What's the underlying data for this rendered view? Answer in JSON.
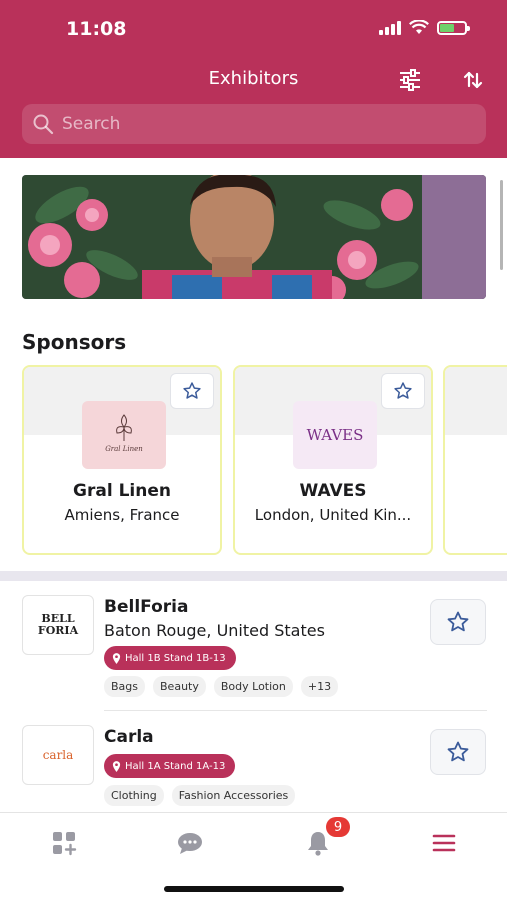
{
  "status_bar": {
    "time": "11:08",
    "battery_color": "#6fd16a"
  },
  "header": {
    "title": "Exhibitors",
    "filter_icon": "sliders-icon",
    "sort_icon": "sort-arrows-icon",
    "bg_color": "#b9315a"
  },
  "search": {
    "placeholder": "Search"
  },
  "sponsors": {
    "title": "Sponsors",
    "items": [
      {
        "name": "Gral Linen",
        "location": "Amiens, France",
        "logo_text": "Gral Linen"
      },
      {
        "name": "WAVES",
        "location": "London, United Kin...",
        "logo_text": "WAVES"
      }
    ]
  },
  "exhibitors": [
    {
      "name": "BellForia",
      "location": "Baton Rouge, United States",
      "stand": "Hall 1B Stand 1B-13",
      "logo_text": "BELL FORIA",
      "tags": [
        "Bags",
        "Beauty",
        "Body Lotion",
        "+13"
      ]
    },
    {
      "name": "Carla",
      "location": "",
      "stand": "Hall 1A Stand 1A-13",
      "logo_text": "carla",
      "tags": [
        "Clothing",
        "Fashion Accessories"
      ]
    }
  ],
  "tabbar": {
    "notification_count": "9",
    "accent": "#b9315a"
  }
}
